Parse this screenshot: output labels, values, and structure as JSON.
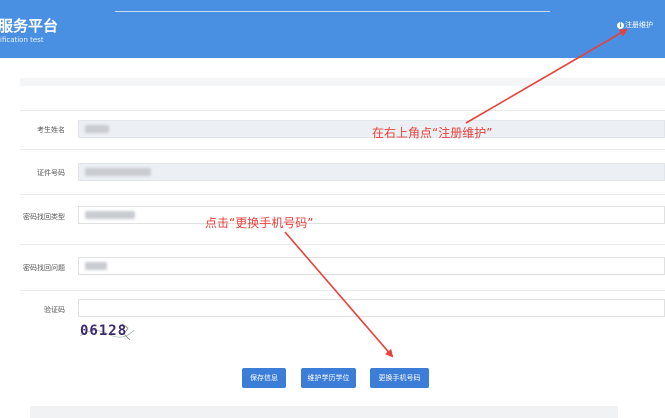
{
  "header": {
    "title": "服务平台",
    "subtitle": "ification test",
    "register_link": "注册维护",
    "info_icon": "i"
  },
  "form": {
    "rows": [
      {
        "label": "考生姓名"
      },
      {
        "label": "证件号码"
      },
      {
        "label": "密码找回类型"
      },
      {
        "label": "密码找回问题"
      },
      {
        "label": "验证码"
      }
    ],
    "captcha_text": "06128"
  },
  "annotations": {
    "top_right_hint": "在右上角点“注册维护”",
    "change_phone_hint": "点击“更换手机号码”",
    "color": "#e8413a"
  },
  "buttons": {
    "save": "保存信息",
    "maintain_degree": "维护学历学位",
    "change_phone": "更换手机号码"
  },
  "colors": {
    "header": "#4a90e2",
    "button": "#3c7dd8"
  }
}
